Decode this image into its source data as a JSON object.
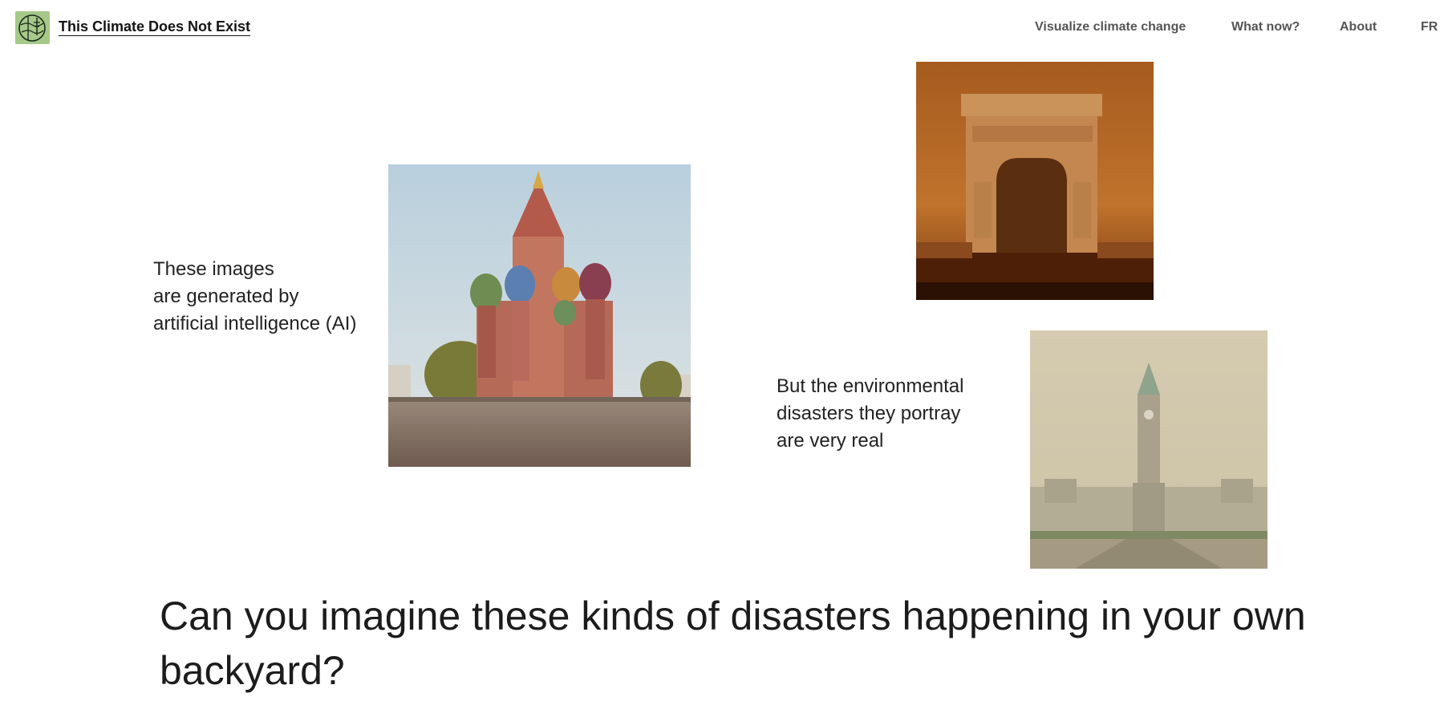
{
  "header": {
    "logo_icon": "climate-globe-logo",
    "title": "This Climate Does Not Exist",
    "nav": [
      "Visualize climate change",
      "What now?",
      "About",
      "FR"
    ]
  },
  "images": {
    "moscow": "flooded-saint-basils-cathedral",
    "paris": "smoke-arc-de-triomphe",
    "ottawa": "smog-parliament-hill"
  },
  "captions": {
    "left": [
      "These images",
      "are generated by",
      "artificial intelligence (AI)"
    ],
    "right": [
      "But the environmental",
      "disasters they portray",
      "are very real"
    ]
  },
  "headline": "Can you imagine these kinds of disasters happening in your own backyard?",
  "colors": {
    "logo_bg": "#a6c889",
    "smoke_orange": "#b5621f",
    "smog_beige": "#d6ccae"
  }
}
